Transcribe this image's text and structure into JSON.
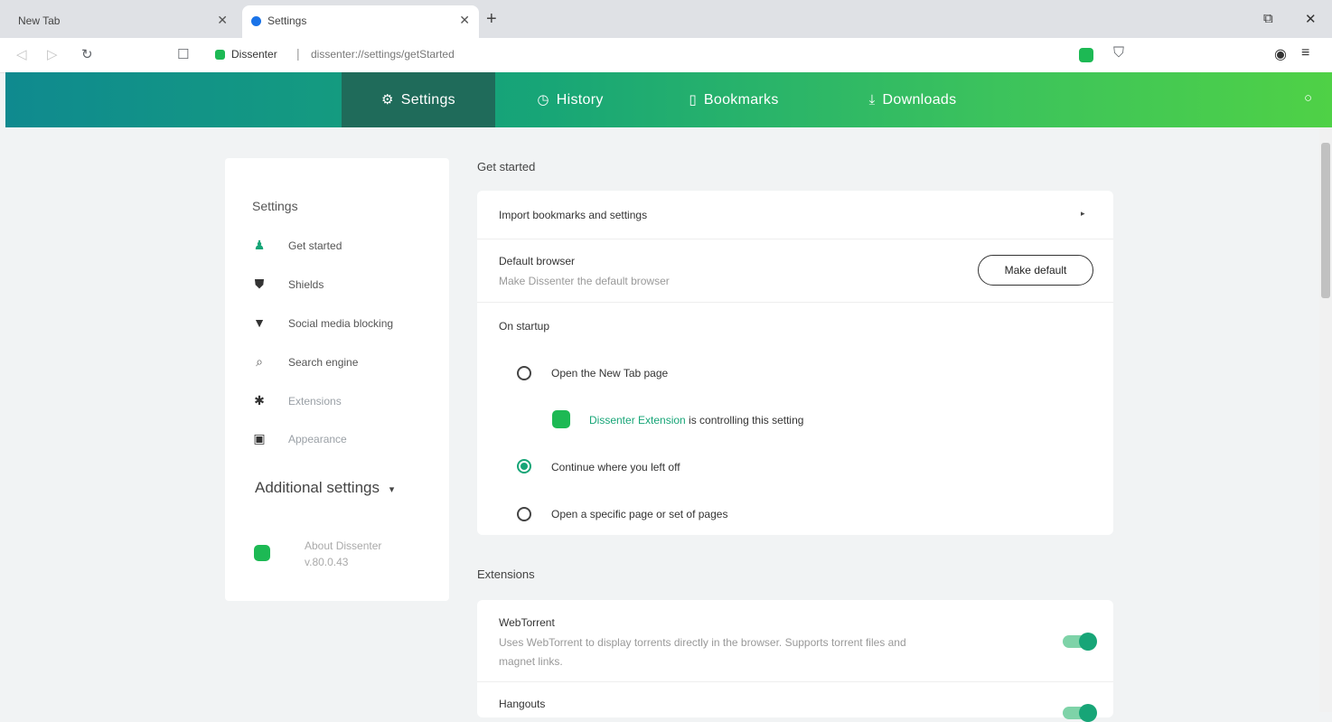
{
  "browser": {
    "tabs": [
      {
        "label": "New Tab",
        "active": false
      },
      {
        "label": "Settings",
        "active": true
      }
    ],
    "new_tab_symbol": "+",
    "address": {
      "site_name": "Dissenter",
      "separator": "|",
      "url": "dissenter://settings/getStarted"
    },
    "icons": {
      "back": "back-arrow-icon",
      "forward": "forward-arrow-icon",
      "reload": "reload-icon",
      "bookmark": "bookmark-icon",
      "extension": "dissenter-extension-icon",
      "shield": "shield-icon",
      "profile": "profile-icon",
      "menu": "menu-icon"
    }
  },
  "header": {
    "nav": [
      {
        "label": "Settings",
        "icon": "gear-icon",
        "active": true
      },
      {
        "label": "History",
        "icon": "clock-icon",
        "active": false
      },
      {
        "label": "Bookmarks",
        "icon": "bookmark-icon",
        "active": false
      },
      {
        "label": "Downloads",
        "icon": "download-icon",
        "active": false
      }
    ],
    "colors": {
      "gradient_start": "#0f8a8f",
      "gradient_end": "#4fd146",
      "active_tab": "#1f6b5a"
    }
  },
  "sidebar": {
    "title": "Settings",
    "items": [
      {
        "label": "Get started",
        "icon": "person-icon"
      },
      {
        "label": "Shields",
        "icon": "shield-icon"
      },
      {
        "label": "Social media blocking",
        "icon": "thumbs-down-icon"
      },
      {
        "label": "Search engine",
        "icon": "search-icon"
      },
      {
        "label": "Extensions",
        "icon": "puzzle-icon"
      },
      {
        "label": "Appearance",
        "icon": "appearance-icon"
      }
    ],
    "additional": "Additional settings",
    "about_line1": "About Dissenter",
    "about_line2": "v.80.0.43"
  },
  "main": {
    "get_started": {
      "title": "Get started",
      "import_label": "Import bookmarks and settings",
      "default_browser_title": "Default browser",
      "default_browser_sub": "Make Dissenter the default browser",
      "make_default_label": "Make default",
      "on_startup_title": "On startup",
      "options": [
        {
          "label": "Open the New Tab page",
          "checked": false
        },
        {
          "label": "Continue where you left off",
          "checked": true
        },
        {
          "label": "Open a specific page or set of pages",
          "checked": false
        }
      ],
      "ext_link": "Dissenter Extension",
      "ext_rest": " is controlling this setting"
    },
    "extensions": {
      "title": "Extensions",
      "webtorrent_title": "WebTorrent",
      "webtorrent_sub1": "Uses WebTorrent to display torrents directly in the browser. Supports torrent files and",
      "webtorrent_sub2": "magnet links.",
      "webtorrent_enabled": true,
      "hangouts_title": "Hangouts",
      "hangouts_enabled": true
    },
    "accent": "#17a577"
  }
}
